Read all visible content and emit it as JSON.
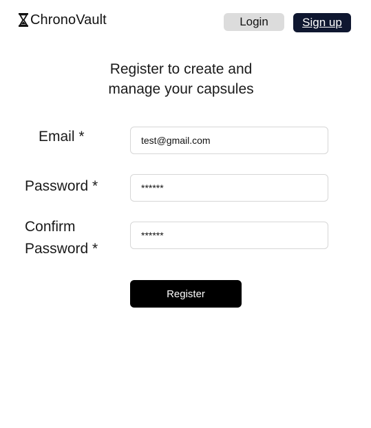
{
  "header": {
    "brand_name": "ChronoVault",
    "brand_icon": "hourglass-icon",
    "login_label": "Login",
    "signup_label": "Sign up"
  },
  "heading": {
    "line1": "Register to create and",
    "line2": "manage your capsules"
  },
  "form": {
    "email": {
      "label": "Email *",
      "value": "test@gmail.com"
    },
    "password": {
      "label": "Password *",
      "value": "******"
    },
    "confirm_password": {
      "label_line1": "Confirm",
      "label_line2": "Password *",
      "value": "******"
    },
    "register_label": "Register"
  },
  "colors": {
    "signup_bg": "#0f1730",
    "login_bg": "#dcdcdc",
    "register_bg": "#000000"
  }
}
